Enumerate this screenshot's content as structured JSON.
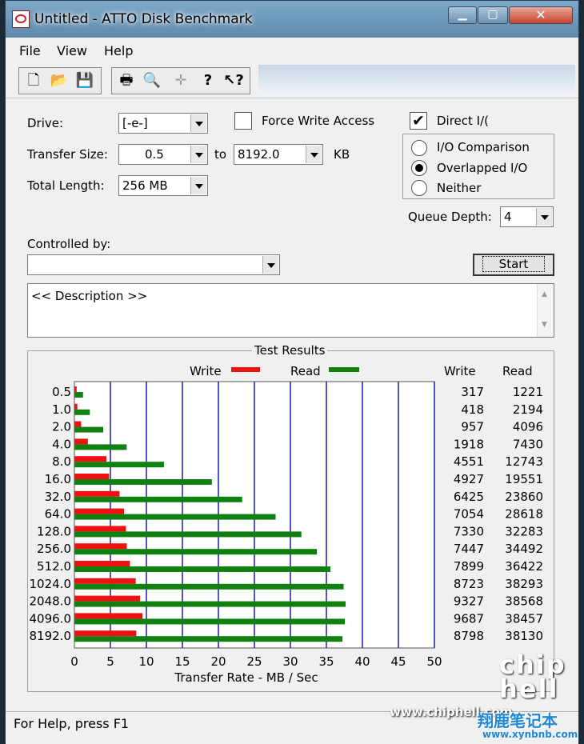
{
  "window": {
    "title": "Untitled - ATTO Disk Benchmark",
    "min_glyph": "▁",
    "max_glyph": "▢",
    "close_glyph": "✕"
  },
  "menu": [
    "File",
    "View",
    "Help"
  ],
  "toolbar": {
    "icons": [
      "new-icon",
      "open-icon",
      "save-icon",
      "print-icon",
      "print-preview-icon",
      "move-icon",
      "help-icon",
      "context-help-icon"
    ]
  },
  "form": {
    "drive_label": "Drive:",
    "drive_value": "[-e-]",
    "force_write_label": "Force Write Access",
    "force_write_checked": false,
    "direct_io_label": "Direct I/(",
    "direct_io_checked": true,
    "check_mark": "✔",
    "transfer_size_label": "Transfer Size:",
    "transfer_from": "0.5",
    "to_label": "to",
    "transfer_to": "8192.0",
    "kb_label": "KB",
    "total_length_label": "Total Length:",
    "total_length_value": "256 MB",
    "io_options": [
      {
        "label": "I/O Comparison",
        "selected": false
      },
      {
        "label": "Overlapped I/O",
        "selected": true
      },
      {
        "label": "Neither",
        "selected": false
      }
    ],
    "queue_depth_label": "Queue Depth:",
    "queue_depth_value": "4",
    "controlled_by_label": "Controlled by:",
    "controlled_by_value": "",
    "start_label": "Start",
    "description": "<< Description >>"
  },
  "chart_data": {
    "type": "bar",
    "title": "Test Results",
    "xlabel": "Transfer Rate - MB / Sec",
    "xlim": [
      0,
      50
    ],
    "xticks": [
      "0",
      "5",
      "10",
      "15",
      "20",
      "25",
      "30",
      "35",
      "40",
      "45",
      "50"
    ],
    "legend": {
      "write_label": "Write",
      "read_label": "Read",
      "placement": "top"
    },
    "col_headers": {
      "write": "Write",
      "read": "Read"
    },
    "colors": {
      "write": "#f01010",
      "read": "#108010",
      "grid": "#1a1ab0"
    },
    "categories": [
      "0.5",
      "1.0",
      "2.0",
      "4.0",
      "8.0",
      "16.0",
      "32.0",
      "64.0",
      "128.0",
      "256.0",
      "512.0",
      "1024.0",
      "2048.0",
      "4096.0",
      "8192.0"
    ],
    "write_values": [
      317,
      418,
      957,
      1918,
      4551,
      4927,
      6425,
      7054,
      7330,
      7447,
      7899,
      8723,
      9327,
      9687,
      8798
    ],
    "read_values": [
      1221,
      2194,
      4096,
      7430,
      12743,
      19551,
      23860,
      28618,
      32283,
      34492,
      36422,
      38293,
      38568,
      38457,
      38130
    ],
    "bar_units_divisor": 1024
  },
  "status": {
    "text": "For Help, press F1"
  },
  "watermark": {
    "site": "www.chiphell.com",
    "logo": "chip hell",
    "cn_site": "www.xynbnb.com",
    "cn_text": "翔鹿笔记本"
  }
}
